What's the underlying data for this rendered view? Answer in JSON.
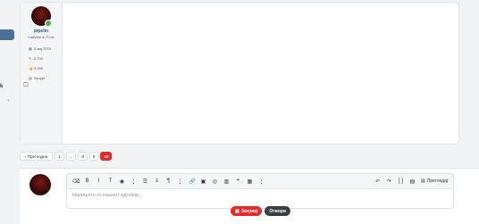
{
  "user": {
    "name": "pipelin",
    "title": "Caffeine & IT.me",
    "stats": [
      {
        "icon": "calendar-icon",
        "glyph": "▦",
        "value": "8 мај 2019"
      },
      {
        "icon": "messages-icon",
        "glyph": "✎",
        "value": "2.730"
      },
      {
        "icon": "like-icon",
        "glyph": "👍",
        "value": "3.399"
      },
      {
        "icon": "location-icon",
        "glyph": "▤",
        "value": "Skopje"
      }
    ]
  },
  "left_sidebar": {
    "letter": "k",
    "chevron": "⌄"
  },
  "pagination": {
    "prev_label": "Претходна",
    "pages": [
      "1",
      "...",
      "8",
      "9",
      "10"
    ],
    "active": "10"
  },
  "editor": {
    "placeholder": "Напишете го вашиот одговор...",
    "preview_label": "Прегледај",
    "toolbar_left": [
      {
        "name": "eraser-icon",
        "glyph": "⌫"
      },
      {
        "name": "bold-icon",
        "glyph": "B"
      },
      {
        "name": "italic-icon",
        "glyph": "I"
      },
      {
        "name": "text-size-icon",
        "glyph": "T"
      },
      {
        "name": "color-icon",
        "glyph": "◉"
      },
      {
        "name": "more-icon",
        "glyph": "⋮"
      },
      {
        "name": "list-icon",
        "glyph": "☰"
      },
      {
        "name": "align-icon",
        "glyph": "≡"
      },
      {
        "name": "paragraph-icon",
        "glyph": "¶"
      },
      {
        "name": "more-icon-2",
        "glyph": "⋮"
      },
      {
        "name": "link-icon",
        "glyph": "🔗"
      },
      {
        "name": "image-icon",
        "glyph": "▣"
      },
      {
        "name": "media-icon",
        "glyph": "◎"
      },
      {
        "name": "gallery-icon",
        "glyph": "▥"
      },
      {
        "name": "quote-icon",
        "glyph": "❞"
      },
      {
        "name": "table-icon",
        "glyph": "▦"
      },
      {
        "name": "more-icon-3",
        "glyph": "⋮"
      }
    ],
    "toolbar_right": [
      {
        "name": "undo-icon",
        "glyph": "↶"
      },
      {
        "name": "redo-icon",
        "glyph": "↷"
      },
      {
        "name": "code-icon",
        "glyph": "[ ]"
      },
      {
        "name": "save-draft-icon",
        "glyph": "▤"
      }
    ]
  },
  "actions": {
    "save_label": "Зачувај",
    "save_glyph": "▣",
    "attach_label": "Отвори"
  }
}
